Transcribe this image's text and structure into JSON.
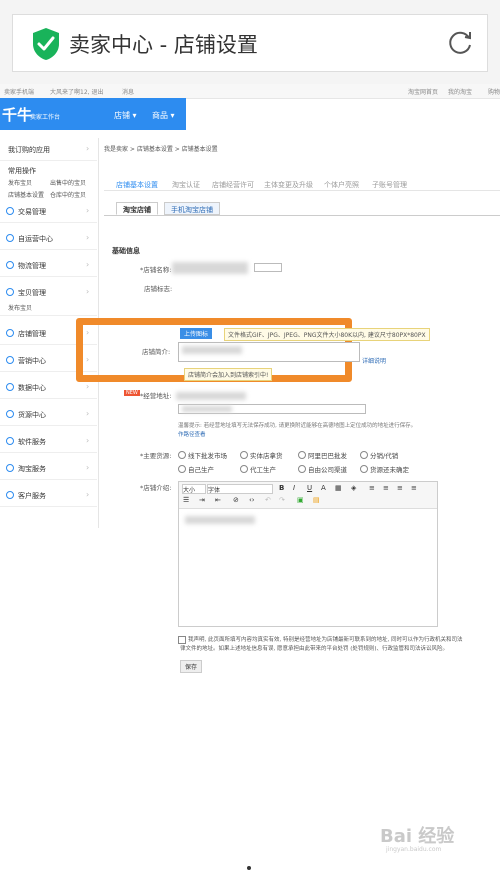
{
  "banner": {
    "title": "卖家中心 - 店铺设置"
  },
  "topbar": {
    "left": "卖家手机端",
    "mid": "大风来了啊12, 退出",
    "msg": "消息",
    "right1": "淘宝网首页",
    "right2": "我的淘宝",
    "right3": "购物车"
  },
  "brand": {
    "logo": "千牛",
    "sub": "卖家工作台",
    "nav1": "店铺 ▾",
    "nav2": "商品 ▾"
  },
  "sidebar": {
    "my_apps": "我订购的应用",
    "common_ops": "常用操作",
    "quick": [
      "发布宝贝",
      "出售中的宝贝",
      "店铺基本设置",
      "仓库中的宝贝"
    ],
    "items": [
      "交易管理",
      "自运营中心",
      "物流管理",
      "宝贝管理",
      "店铺管理",
      "营销中心",
      "数据中心",
      "货源中心",
      "软件服务",
      "淘宝服务",
      "客户服务"
    ],
    "baobei_sub": "发布宝贝"
  },
  "breadcrumb": "我是卖家 > 店铺基本设置 > 店铺基本设置",
  "tabs": [
    "店铺基本设置",
    "淘宝认证",
    "店铺经营许可",
    "主体变更及升级",
    "个体户亮照",
    "子账号管理"
  ],
  "subtabs": [
    "淘宝店铺",
    "手机淘宝店铺"
  ],
  "form": {
    "section": "基础信息",
    "shop_name_label": "*店铺名称:",
    "shop_logo_label": "店铺标志:",
    "upload_btn": "上传图标",
    "upload_tip": "文件格式GIF、JPG、JPEG、PNG文件大小80K以内, 建议尺寸80PX*80PX",
    "intro_label": "店铺简介:",
    "detail_link": "详细说明",
    "index_tip": "店铺简介会加入到店铺索引中!",
    "new_badge": "NEW",
    "address_label": "*经营地址:",
    "address_tip": "温馨提示: 若经营地址填写无法保存成功, 请更换附近能够在高德地图上定位成功的地址进行保存。",
    "address_tip2": "作路径查看",
    "goods_label": "*主要货源:",
    "goods": [
      "线下批发市场",
      "实体店拿货",
      "阿里巴巴批发",
      "分销/代销",
      "自己生产",
      "代工生产",
      "自由公司渠道",
      "货源还未确定"
    ],
    "intro2_label": "*店铺介绍:",
    "font_size": "大小",
    "font_face": "字体",
    "agreement": "我声明, 此页面所填写内容均真实有效, 特别是经营地址为店铺最新可联系到的地址, 同时可以作为行政机关和司法",
    "agreement2": "律文件的地址。如果上述地址信息有误, 愿意承担由此带来的平台处罚 (处罚规则)、行政监管和司法诉讼风险。",
    "save": "保存"
  },
  "watermark": {
    "main": "Bai 经验",
    "sub": "jingyan.baidu.com"
  },
  "colors": {
    "accent": "#2d8cf0",
    "highlight": "#f08a2a"
  }
}
